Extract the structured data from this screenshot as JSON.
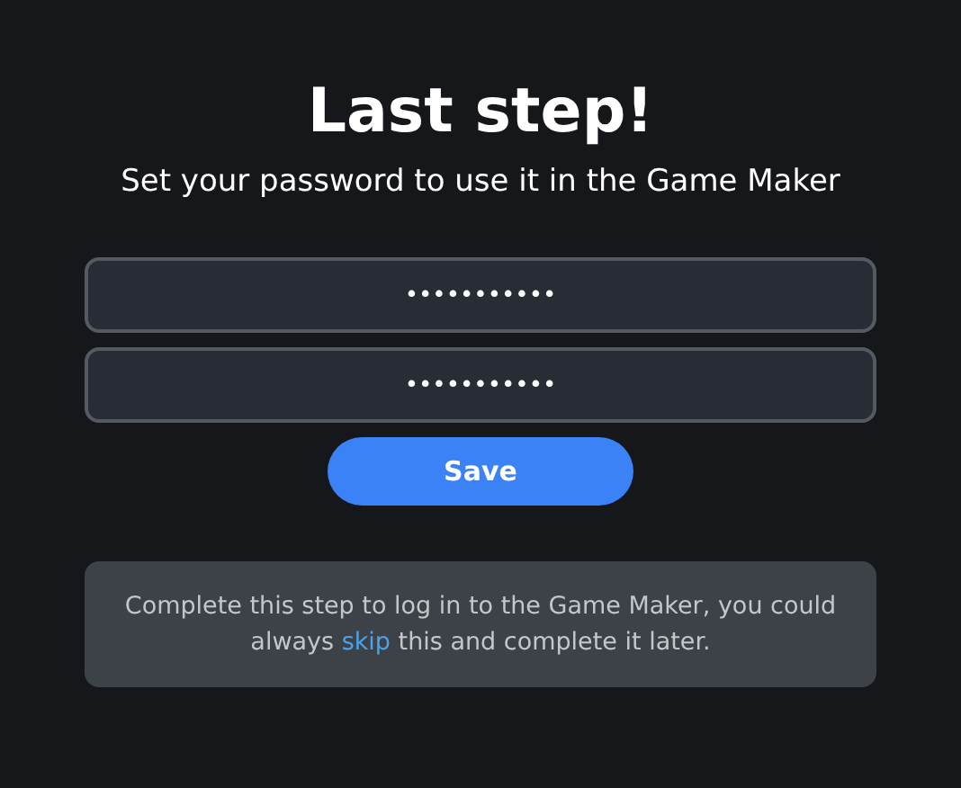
{
  "title": "Last step!",
  "subtitle": "Set your password to use it in the Game Maker",
  "fields": [
    {
      "value": "•••••••••••"
    },
    {
      "value": "•••••••••••"
    }
  ],
  "save_button": "Save",
  "note": {
    "before": "Complete this step to log in to the Game Maker, you could always",
    "link": "skip",
    "after": "this and complete it later."
  }
}
